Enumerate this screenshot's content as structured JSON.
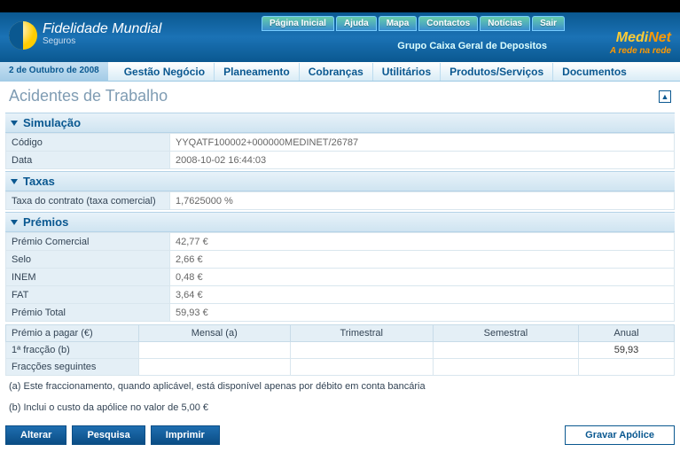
{
  "topnav": {
    "home": "Página Inicial",
    "help": "Ajuda",
    "map": "Mapa",
    "contacts": "Contactos",
    "news": "Notícias",
    "exit": "Sair"
  },
  "brand": {
    "name": "Fidelidade Mundial",
    "sub": "Seguros",
    "group": "Grupo Caixa Geral de Depositos",
    "medinet": "MediNet",
    "tagline": "A rede na rede"
  },
  "date": "2 de Outubro de 2008",
  "menu": {
    "gestao": "Gestão Negócio",
    "plane": "Planeamento",
    "cobr": "Cobranças",
    "util": "Utilitários",
    "prod": "Produtos/Serviços",
    "doc": "Documentos"
  },
  "page_title": "Acidentes de Trabalho",
  "simulacao": {
    "title": "Simulação",
    "codigo_label": "Código",
    "codigo": "YYQATF100002+000000MEDINET/26787",
    "data_label": "Data",
    "data": "2008-10-02 16:44:03"
  },
  "taxas": {
    "title": "Taxas",
    "taxa_label": "Taxa do contrato (taxa comercial)",
    "taxa": "1,7625000 %"
  },
  "premios": {
    "title": "Prémios",
    "rows": [
      {
        "label": "Prémio Comercial",
        "value": "42,77 €"
      },
      {
        "label": "Selo",
        "value": "2,66 €"
      },
      {
        "label": "INEM",
        "value": "0,48 €"
      },
      {
        "label": "FAT",
        "value": "3,64 €"
      },
      {
        "label": "Prémio Total",
        "value": "59,93 €"
      }
    ]
  },
  "grid": {
    "headers": {
      "c0": "Prémio a pagar (€)",
      "c1": "Mensal (a)",
      "c2": "Trimestral",
      "c3": "Semestral",
      "c4": "Anual"
    },
    "row1": {
      "label": "1ª fracção (b)",
      "anual": "59,93"
    },
    "row2": {
      "label": "Fracções seguintes"
    }
  },
  "note_a": "(a) Este fraccionamento, quando aplicável, está disponível apenas por débito em conta bancária",
  "note_b": "(b) Inclui o custo da apólice no valor de 5,00 €",
  "buttons": {
    "alterar": "Alterar",
    "pesquisa": "Pesquisa",
    "imprimir": "Imprimir",
    "gravar": "Gravar Apólice"
  }
}
